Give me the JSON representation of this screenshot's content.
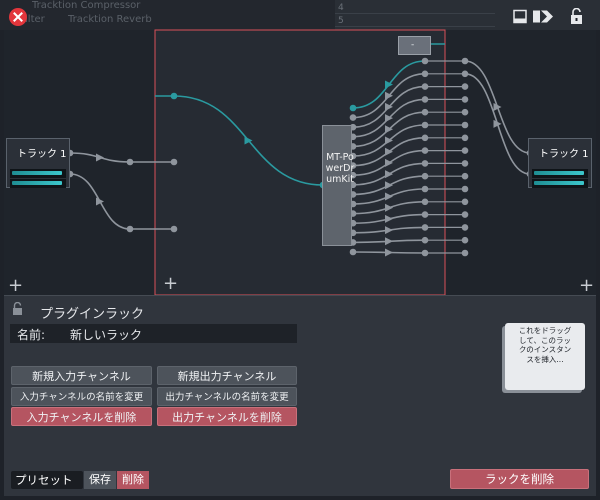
{
  "background": {
    "plugin_list": [
      "Tracktion Compressor",
      "Filter",
      "Tracktion Reverb"
    ],
    "right_rows": [
      "4",
      "5"
    ]
  },
  "graph": {
    "input_box": {
      "title": "トラック 1"
    },
    "output_box": {
      "title": "トラック 1"
    },
    "plugin": {
      "name": "MT-PowerDrumKit"
    },
    "gain_box": {
      "label": "-"
    }
  },
  "panel": {
    "title": "プラグインラック",
    "name_label": "名前:",
    "name_value": "新しいラック",
    "buttons": {
      "new_input": "新規入力チャンネル",
      "new_output": "新規出力チャンネル",
      "rename_input": "入力チャンネルの名前を変更",
      "rename_output": "出力チャンネルの名前を変更",
      "delete_input": "入力チャンネルを削除",
      "delete_output": "出力チャンネルを削除"
    },
    "drag_hint": "これをドラッグして、このラックのインスタンスを挿入...",
    "preset_label": "プリセット",
    "save": "保存",
    "delete": "削除",
    "delete_rack": "ラックを削除"
  },
  "colors": {
    "accent": "#2a9aa0",
    "danger": "#b55561",
    "selection_border": "#d9505a"
  },
  "icons": {
    "close": "close-icon",
    "window": "window-icon",
    "expand": "expand-icon",
    "lock": "lock-icon"
  }
}
